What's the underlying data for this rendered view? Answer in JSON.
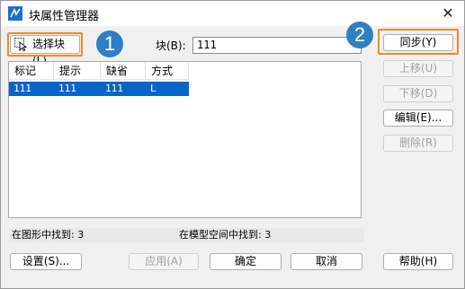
{
  "window": {
    "title": "块属性管理器",
    "close_glyph": "✕"
  },
  "toolbar": {
    "select_block_label": "选择块(L)",
    "block_label": "块(B):",
    "block_value": "111",
    "sync_label": "同步(Y)"
  },
  "badges": {
    "one": "1",
    "two": "2"
  },
  "table": {
    "headers": [
      "标记",
      "提示",
      "缺省",
      "方式"
    ],
    "rows": [
      {
        "tag": "111",
        "prompt": "111",
        "default": "111",
        "mode": "L"
      }
    ]
  },
  "side_buttons": {
    "move_up": "上移(U)",
    "move_down": "下移(D)",
    "edit": "编辑(E)...",
    "delete": "删除(R)"
  },
  "status": {
    "in_drawing": "在图形中找到: 3",
    "in_modelspace": "在模型空间中找到: 3"
  },
  "footer": {
    "settings": "设置(S)...",
    "apply": "应用(A)",
    "ok": "确定",
    "cancel": "取消",
    "help": "帮助(H)"
  },
  "colors": {
    "accent_highlight": "#f08a24",
    "badge": "#2f7fc4",
    "selection": "#0a64c8"
  }
}
